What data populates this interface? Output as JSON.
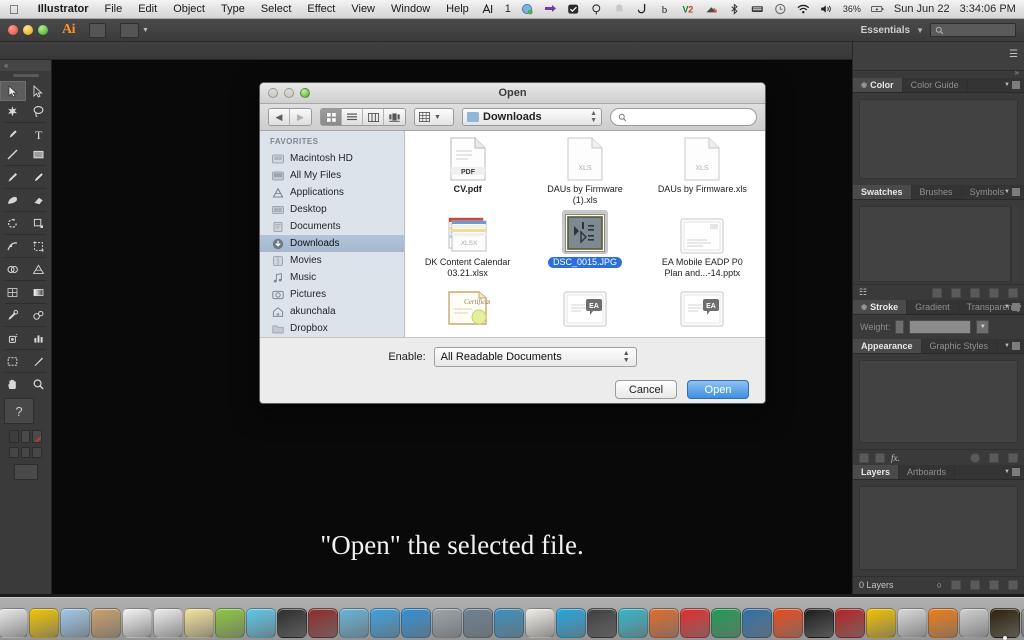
{
  "menubar": {
    "apple_icon": "apple-icon",
    "items": [
      {
        "label": "Illustrator",
        "bold": true
      },
      {
        "label": "File",
        "bold": false
      },
      {
        "label": "Edit",
        "bold": false
      },
      {
        "label": "Object",
        "bold": false
      },
      {
        "label": "Type",
        "bold": false
      },
      {
        "label": "Select",
        "bold": false
      },
      {
        "label": "Effect",
        "bold": false
      },
      {
        "label": "View",
        "bold": false
      },
      {
        "label": "Window",
        "bold": false
      },
      {
        "label": "Help",
        "bold": false
      }
    ],
    "status": {
      "app_switcher": "1",
      "battery_percent": "36%",
      "date": "Sun Jun 22",
      "time": "3:34:06 PM",
      "icons": [
        "app-switcher-icon",
        "sync-icon",
        "vpn-icon",
        "dropbox-icon",
        "location-icon",
        "bell-icon",
        "phone-icon",
        "backblaze-icon",
        "virtualbox-icon",
        "cloud-icon",
        "bluetooth-icon",
        "keyboard-icon",
        "timemachine-icon",
        "wifi-icon",
        "volume-icon",
        "battery-icon",
        "spotlight-search-icon",
        "notification-center-icon"
      ]
    }
  },
  "appbar": {
    "app_name": "Ai",
    "bridge_button": "bridge-button",
    "arrange_button": "arrange-documents-button",
    "workspace_label": "Essentials",
    "search_placeholder": ""
  },
  "toolbar": {
    "tools": [
      {
        "name": "selection-tool",
        "selected": true
      },
      {
        "name": "direct-selection-tool",
        "selected": false
      },
      {
        "name": "magic-wand-tool",
        "selected": false
      },
      {
        "name": "lasso-tool",
        "selected": false
      },
      {
        "name": "pen-tool",
        "selected": false
      },
      {
        "name": "type-tool",
        "selected": false
      },
      {
        "name": "line-segment-tool",
        "selected": false
      },
      {
        "name": "rectangle-tool",
        "selected": false
      },
      {
        "name": "paintbrush-tool",
        "selected": false
      },
      {
        "name": "pencil-tool",
        "selected": false
      },
      {
        "name": "blob-brush-tool",
        "selected": false
      },
      {
        "name": "eraser-tool",
        "selected": false
      },
      {
        "name": "rotate-tool",
        "selected": false
      },
      {
        "name": "scale-tool",
        "selected": false
      },
      {
        "name": "width-tool",
        "selected": false
      },
      {
        "name": "free-transform-tool",
        "selected": false
      },
      {
        "name": "shape-builder-tool",
        "selected": false
      },
      {
        "name": "perspective-grid-tool",
        "selected": false
      },
      {
        "name": "mesh-tool",
        "selected": false
      },
      {
        "name": "gradient-tool",
        "selected": false
      },
      {
        "name": "eyedropper-tool",
        "selected": false
      },
      {
        "name": "blend-tool",
        "selected": false
      },
      {
        "name": "symbol-sprayer-tool",
        "selected": false
      },
      {
        "name": "column-graph-tool",
        "selected": false
      },
      {
        "name": "artboard-tool",
        "selected": false
      },
      {
        "name": "slice-tool",
        "selected": false
      },
      {
        "name": "hand-tool",
        "selected": false
      },
      {
        "name": "zoom-tool",
        "selected": false
      }
    ],
    "help_label": "?",
    "fill_stroke": [
      "fill-swatch",
      "stroke-swatch",
      "none-swatch"
    ],
    "color_modes": [
      "color-mode",
      "gradient-mode",
      "none-mode"
    ],
    "screen_mode": "screen-mode-button"
  },
  "canvas": {
    "caption": "\"Open\" the selected file."
  },
  "panels": {
    "groups": [
      {
        "name": "color-panel-group",
        "tabs": [
          {
            "label": "Color",
            "active": true,
            "dot": true
          },
          {
            "label": "Color Guide",
            "active": false,
            "dot": false
          }
        ]
      },
      {
        "name": "swatches-panel-group",
        "tabs": [
          {
            "label": "Swatches",
            "active": true,
            "dot": false
          },
          {
            "label": "Brushes",
            "active": false,
            "dot": false
          },
          {
            "label": "Symbols",
            "active": false,
            "dot": false
          }
        ]
      },
      {
        "name": "stroke-panel-group",
        "tabs": [
          {
            "label": "Stroke",
            "active": true,
            "dot": true
          },
          {
            "label": "Gradient",
            "active": false,
            "dot": false
          },
          {
            "label": "Transparency",
            "active": false,
            "dot": false
          }
        ],
        "weight_label": "Weight:"
      },
      {
        "name": "appearance-panel-group",
        "tabs": [
          {
            "label": "Appearance",
            "active": true,
            "dot": false
          },
          {
            "label": "Graphic Styles",
            "active": false,
            "dot": false
          }
        ],
        "fx_label": "fx."
      },
      {
        "name": "layers-panel-group",
        "tabs": [
          {
            "label": "Layers",
            "active": true,
            "dot": false
          },
          {
            "label": "Artboards",
            "active": false,
            "dot": false
          }
        ],
        "status": "0 Layers"
      }
    ]
  },
  "dialog": {
    "title": "Open",
    "window_buttons": [
      "close-button",
      "minimize-button",
      "zoom-button"
    ],
    "toolbar": {
      "back_label": "◀",
      "forward_label": "▶",
      "view_modes": [
        "icon-view",
        "list-view",
        "column-view",
        "coverflow-view"
      ],
      "arrange_label": "arrange-button",
      "location": "Downloads",
      "search_placeholder": ""
    },
    "sidebar": {
      "header": "FAVORITES",
      "items": [
        {
          "label": "Macintosh HD",
          "icon": "harddisk-icon",
          "selected": false
        },
        {
          "label": "All My Files",
          "icon": "allmyfiles-icon",
          "selected": false
        },
        {
          "label": "Applications",
          "icon": "applications-icon",
          "selected": false
        },
        {
          "label": "Desktop",
          "icon": "desktop-icon",
          "selected": false
        },
        {
          "label": "Documents",
          "icon": "documents-icon",
          "selected": false
        },
        {
          "label": "Downloads",
          "icon": "downloads-icon",
          "selected": true
        },
        {
          "label": "Movies",
          "icon": "movies-icon",
          "selected": false
        },
        {
          "label": "Music",
          "icon": "music-icon",
          "selected": false
        },
        {
          "label": "Pictures",
          "icon": "pictures-icon",
          "selected": false
        },
        {
          "label": "akunchala",
          "icon": "home-icon",
          "selected": false
        },
        {
          "label": "Dropbox",
          "icon": "folder-icon",
          "selected": false
        }
      ]
    },
    "files": [
      {
        "label": "CV.pdf",
        "kind": "pdf",
        "badge": "PDF",
        "selected": false,
        "bold": true
      },
      {
        "label": "DAUs by Firmware (1).xls",
        "kind": "xls",
        "badge": "XLS",
        "selected": false,
        "bold": false
      },
      {
        "label": "DAUs by Firmware.xls",
        "kind": "xls",
        "badge": "XLS",
        "selected": false,
        "bold": false
      },
      {
        "label": "DK Content Calendar 03.21.xlsx",
        "kind": "xlsx",
        "badge": "XLSX",
        "selected": false,
        "bold": false
      },
      {
        "label": "DSC_0015.JPG",
        "kind": "jpg",
        "badge": "",
        "selected": true,
        "bold": false
      },
      {
        "label": "EA Mobile EADP P0 Plan and...-14.pptx",
        "kind": "pptx",
        "badge": "",
        "selected": false,
        "bold": false
      },
      {
        "label": "",
        "kind": "certificate",
        "badge": "",
        "selected": false,
        "bold": false
      },
      {
        "label": "",
        "kind": "ea-doc",
        "badge": "",
        "selected": false,
        "bold": false
      },
      {
        "label": "",
        "kind": "ea-doc",
        "badge": "",
        "selected": false,
        "bold": false
      }
    ],
    "enable_label": "Enable:",
    "enable_value": "All Readable Documents",
    "cancel_label": "Cancel",
    "open_label": "Open"
  },
  "dock": {
    "items": [
      {
        "name": "finder",
        "color": "#4a9fe0"
      },
      {
        "name": "launchpad",
        "color": "#c9ced4"
      },
      {
        "name": "mission-control",
        "color": "#3b4a58"
      },
      {
        "name": "safari",
        "color": "#2f81d6"
      },
      {
        "name": "notes-app",
        "color": "#2a6fc9"
      },
      {
        "name": "chrome",
        "color": "#e8e8e8"
      },
      {
        "name": "chrome-canary",
        "color": "#f2c300"
      },
      {
        "name": "preview",
        "color": "#9fc7e8"
      },
      {
        "name": "address-book",
        "color": "#c9a06a"
      },
      {
        "name": "calendar",
        "color": "#f4f4f4"
      },
      {
        "name": "reminders",
        "color": "#ededed"
      },
      {
        "name": "notes",
        "color": "#f5e39a"
      },
      {
        "name": "evernote",
        "color": "#8cc63e"
      },
      {
        "name": "messages",
        "color": "#5bc7ea"
      },
      {
        "name": "facetime",
        "color": "#2b2b2b"
      },
      {
        "name": "imovie",
        "color": "#8e2828"
      },
      {
        "name": "iphoto",
        "color": "#66b3d9"
      },
      {
        "name": "itunes",
        "color": "#3aa0e0"
      },
      {
        "name": "app-store",
        "color": "#2f8fd8"
      },
      {
        "name": "system-preferences",
        "color": "#9aa3ab"
      },
      {
        "name": "remote-desktop",
        "color": "#6b7f92"
      },
      {
        "name": "skitch",
        "color": "#3a8fbf"
      },
      {
        "name": "popcorn-time",
        "color": "#f0ede6"
      },
      {
        "name": "skype",
        "color": "#22a6e0"
      },
      {
        "name": "charles",
        "color": "#3d3d3d"
      },
      {
        "name": "lastpass",
        "color": "#35b5c9"
      },
      {
        "name": "colorsync",
        "color": "#e06a2a"
      },
      {
        "name": "acrobat",
        "color": "#e02b2b"
      },
      {
        "name": "excel",
        "color": "#1d9b52"
      },
      {
        "name": "cinema",
        "color": "#2f6fa8"
      },
      {
        "name": "pandora",
        "color": "#e8491b"
      },
      {
        "name": "terminal",
        "color": "#1a1a1a"
      },
      {
        "name": "sequel-pro",
        "color": "#b22222"
      },
      {
        "name": "perforce",
        "color": "#f0c000"
      },
      {
        "name": "calculator",
        "color": "#d8d8d8"
      },
      {
        "name": "vlc",
        "color": "#ef7c15"
      },
      {
        "name": "photos",
        "color": "#cfcfcf"
      },
      {
        "name": "illustrator",
        "color": "#2b1f06"
      },
      {
        "name": "unknown-app",
        "color": "#8e8e8e"
      },
      {
        "name": "downloads-stack",
        "color": "#c8c8c8"
      },
      {
        "name": "documents-stack",
        "color": "#a9cfe8"
      },
      {
        "name": "screenshot-stack",
        "color": "#ededed"
      },
      {
        "name": "trash",
        "color": "#b9c3cb"
      }
    ]
  }
}
